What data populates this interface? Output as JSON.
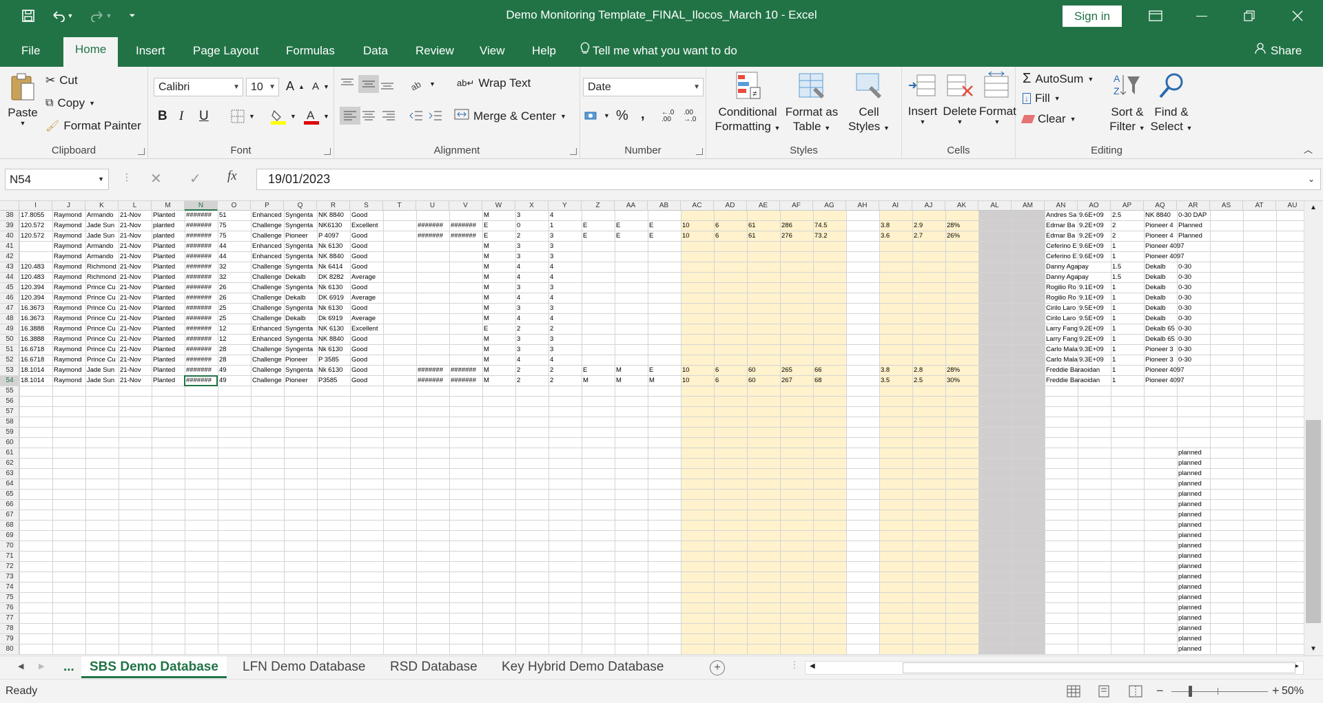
{
  "app": {
    "title": "Demo Monitoring Template_FINAL_Ilocos_March 10  -  Excel",
    "sign_in": "Sign in",
    "share": "Share",
    "tell_me": "Tell me what you want to do"
  },
  "tabs": [
    "File",
    "Home",
    "Insert",
    "Page Layout",
    "Formulas",
    "Data",
    "Review",
    "View",
    "Help"
  ],
  "ribbon": {
    "clipboard": {
      "label": "Clipboard",
      "paste": "Paste",
      "cut": "Cut",
      "copy": "Copy",
      "format_painter": "Format Painter"
    },
    "font": {
      "label": "Font",
      "name": "Calibri",
      "size": "10",
      "bold": "B",
      "italic": "I",
      "underline": "U"
    },
    "alignment": {
      "label": "Alignment",
      "wrap": "Wrap Text",
      "merge": "Merge & Center"
    },
    "number": {
      "label": "Number",
      "format": "Date",
      "percent": "%",
      "comma": ","
    },
    "styles": {
      "label": "Styles",
      "cond1": "Conditional",
      "cond2": "Formatting",
      "fat1": "Format as",
      "fat2": "Table",
      "cs1": "Cell",
      "cs2": "Styles"
    },
    "cells": {
      "label": "Cells",
      "insert": "Insert",
      "delete": "Delete",
      "format": "Format"
    },
    "editing": {
      "label": "Editing",
      "autosum": "AutoSum",
      "fill": "Fill",
      "clear": "Clear",
      "sort1": "Sort &",
      "sort2": "Filter",
      "find1": "Find &",
      "find2": "Select"
    }
  },
  "formula_bar": {
    "name_box": "N54",
    "fx": "fx",
    "value": "19/01/2023"
  },
  "sheet": {
    "columns": [
      "I",
      "J",
      "K",
      "L",
      "M",
      "N",
      "O",
      "P",
      "Q",
      "R",
      "S",
      "T",
      "U",
      "V",
      "W",
      "X",
      "Y",
      "Z",
      "AA",
      "AB",
      "AC",
      "AD",
      "AE",
      "AF",
      "AG",
      "AH",
      "AI",
      "AJ",
      "AK",
      "AL",
      "AM",
      "AN",
      "AO",
      "AP",
      "AQ",
      "AR",
      "AS",
      "AT",
      "AU"
    ],
    "selected_column": "N",
    "row_numbers": [
      "38",
      "39",
      "40",
      "41",
      "42",
      "43",
      "44",
      "45",
      "46",
      "47",
      "48",
      "49",
      "50",
      "51",
      "52",
      "53",
      "54",
      "55",
      "56",
      "57",
      "58",
      "59",
      "60",
      "61",
      "62",
      "63",
      "64",
      "65",
      "66",
      "67",
      "68",
      "69",
      "70",
      "71",
      "72",
      "73",
      "74",
      "75",
      "76",
      "77",
      "78",
      "79",
      "80"
    ],
    "selected_row": "54",
    "rows": [
      [
        "17.8055",
        "Raymond",
        "Armando",
        "21-Nov",
        "Planted",
        "#######",
        "51",
        "Enhanced",
        "Syngenta",
        "NK 8840",
        "Good",
        "",
        "",
        "",
        "M",
        "3",
        "4",
        "",
        "",
        "",
        "",
        "",
        "",
        "",
        "",
        "",
        "",
        "",
        "",
        "",
        "",
        "Andres Sa",
        "9.6E+09",
        "2.5",
        "NK 8840",
        "0-30 DAP",
        "",
        "",
        ""
      ],
      [
        "120.572",
        "Raymond",
        "Jade Sun",
        "21-Nov",
        "planted",
        "#######",
        "75",
        "Challenge",
        "Syngenta",
        "NK6130",
        "Excellent",
        "",
        "#######",
        "#######",
        "E",
        "0",
        "1",
        "E",
        "E",
        "E",
        "10",
        "6",
        "61",
        "286",
        "74.5",
        "",
        "3.8",
        "2.9",
        "28%",
        "",
        "",
        "Edmar Ba",
        "9.2E+09",
        "2",
        "Pioneer 4",
        "Planned",
        "",
        "",
        ""
      ],
      [
        "120.572",
        "Raymond",
        "Jade Sun",
        "21-Nov",
        "planted",
        "#######",
        "75",
        "Challenge",
        "Pioneer",
        "P 4097",
        "Good",
        "",
        "#######",
        "#######",
        "E",
        "2",
        "3",
        "E",
        "E",
        "E",
        "10",
        "6",
        "61",
        "276",
        "73.2",
        "",
        "3.6",
        "2.7",
        "26%",
        "",
        "",
        "Edmar Ba",
        "9.2E+09",
        "2",
        "Pioneer 4",
        "Planned",
        "",
        "",
        ""
      ],
      [
        "",
        "Raymond",
        "Armando",
        "21-Nov",
        "Planted",
        "#######",
        "44",
        "Enhanced",
        "Syngenta",
        "Nk 6130",
        "Good",
        "",
        "",
        "",
        "M",
        "3",
        "3",
        "",
        "",
        "",
        "",
        "",
        "",
        "",
        "",
        "",
        "",
        "",
        "",
        "",
        "",
        "Ceferino E",
        "9.6E+09",
        "1",
        "Pioneer 4097",
        "",
        "",
        "",
        ""
      ],
      [
        "",
        "Raymond",
        "Armando",
        "21-Nov",
        "Planted",
        "#######",
        "44",
        "Enhanced",
        "Syngenta",
        "NK 8840",
        "Good",
        "",
        "",
        "",
        "M",
        "3",
        "3",
        "",
        "",
        "",
        "",
        "",
        "",
        "",
        "",
        "",
        "",
        "",
        "",
        "",
        "",
        "Ceferino E",
        "9.6E+09",
        "1",
        "Pioneer 4097",
        "",
        "",
        "",
        ""
      ],
      [
        "120.483",
        "Raymond",
        "Richmond",
        "21-Nov",
        "Planted",
        "#######",
        "32",
        "Challenge",
        "Syngenta",
        "Nk 6414",
        "Good",
        "",
        "",
        "",
        "M",
        "4",
        "4",
        "",
        "",
        "",
        "",
        "",
        "",
        "",
        "",
        "",
        "",
        "",
        "",
        "",
        "",
        "Danny Agapay",
        "",
        "1.5",
        "Dekalb",
        "0-30",
        "",
        "",
        ""
      ],
      [
        "120.483",
        "Raymond",
        "Richmond",
        "21-Nov",
        "Planted",
        "#######",
        "32",
        "Challenge",
        "Dekalb",
        "DK 8282",
        "Average",
        "",
        "",
        "",
        "M",
        "4",
        "4",
        "",
        "",
        "",
        "",
        "",
        "",
        "",
        "",
        "",
        "",
        "",
        "",
        "",
        "",
        "Danny Agapay",
        "",
        "1.5",
        "Dekalb",
        "0-30",
        "",
        "",
        ""
      ],
      [
        "120.394",
        "Raymond",
        "Prince Cu",
        "21-Nov",
        "Planted",
        "#######",
        "26",
        "Challenge",
        "Syngenta",
        "Nk 6130",
        "Good",
        "",
        "",
        "",
        "M",
        "3",
        "3",
        "",
        "",
        "",
        "",
        "",
        "",
        "",
        "",
        "",
        "",
        "",
        "",
        "",
        "",
        "Rogilio Ro",
        "9.1E+09",
        "1",
        "Dekalb",
        "0-30",
        "",
        "",
        ""
      ],
      [
        "120.394",
        "Raymond",
        "Prince Cu",
        "21-Nov",
        "Planted",
        "#######",
        "26",
        "Challenge",
        "Dekalb",
        "DK 6919",
        "Average",
        "",
        "",
        "",
        "M",
        "4",
        "4",
        "",
        "",
        "",
        "",
        "",
        "",
        "",
        "",
        "",
        "",
        "",
        "",
        "",
        "",
        "Rogilio Ro",
        "9.1E+09",
        "1",
        "Dekalb",
        "0-30",
        "",
        "",
        ""
      ],
      [
        "16.3673",
        "Raymond",
        "Prince Cu",
        "21-Nov",
        "Planted",
        "#######",
        "25",
        "Challenge",
        "Syngenta",
        "Nk 6130",
        "Good",
        "",
        "",
        "",
        "M",
        "3",
        "3",
        "",
        "",
        "",
        "",
        "",
        "",
        "",
        "",
        "",
        "",
        "",
        "",
        "",
        "",
        "Cirilo Laro",
        "9.5E+09",
        "1",
        "Dekalb",
        "0-30",
        "",
        "",
        ""
      ],
      [
        "16.3673",
        "Raymond",
        "Prince Cu",
        "21-Nov",
        "Planted",
        "#######",
        "25",
        "Challenge",
        "Dekalb",
        "Dk 6919",
        "Average",
        "",
        "",
        "",
        "M",
        "4",
        "4",
        "",
        "",
        "",
        "",
        "",
        "",
        "",
        "",
        "",
        "",
        "",
        "",
        "",
        "",
        "Cirilo Laro",
        "9.5E+09",
        "1",
        "Dekalb",
        "0-30",
        "",
        "",
        ""
      ],
      [
        "16.3888",
        "Raymond",
        "Prince Cu",
        "21-Nov",
        "Planted",
        "#######",
        "12",
        "Enhanced",
        "Syngenta",
        "NK 6130",
        "Excellent",
        "",
        "",
        "",
        "E",
        "2",
        "2",
        "",
        "",
        "",
        "",
        "",
        "",
        "",
        "",
        "",
        "",
        "",
        "",
        "",
        "",
        "Larry Fang",
        "9.2E+09",
        "1",
        "Dekalb 65",
        "0-30",
        "",
        "",
        ""
      ],
      [
        "16.3888",
        "Raymond",
        "Prince Cu",
        "21-Nov",
        "Planted",
        "#######",
        "12",
        "Enhanced",
        "Syngenta",
        "NK 8840",
        "Good",
        "",
        "",
        "",
        "M",
        "3",
        "3",
        "",
        "",
        "",
        "",
        "",
        "",
        "",
        "",
        "",
        "",
        "",
        "",
        "",
        "",
        "Larry Fang",
        "9.2E+09",
        "1",
        "Dekalb 65",
        "0-30",
        "",
        "",
        ""
      ],
      [
        "16.6718",
        "Raymond",
        "Prince Cu",
        "21-Nov",
        "Planted",
        "#######",
        "28",
        "Challenge",
        "Syngenta",
        "Nk 6130",
        "Good",
        "",
        "",
        "",
        "M",
        "3",
        "3",
        "",
        "",
        "",
        "",
        "",
        "",
        "",
        "",
        "",
        "",
        "",
        "",
        "",
        "",
        "Carlo Mala",
        "9.3E+09",
        "1",
        "Pioneer 3",
        "0-30",
        "",
        "",
        ""
      ],
      [
        "16.6718",
        "Raymond",
        "Prince Cu",
        "21-Nov",
        "Planted",
        "#######",
        "28",
        "Challenge",
        "Pioneer",
        "P 3585",
        "Good",
        "",
        "",
        "",
        "M",
        "4",
        "4",
        "",
        "",
        "",
        "",
        "",
        "",
        "",
        "",
        "",
        "",
        "",
        "",
        "",
        "",
        "Carlo Mala",
        "9.3E+09",
        "1",
        "Pioneer 3",
        "0-30",
        "",
        "",
        ""
      ],
      [
        "18.1014",
        "Raymond",
        "Jade Sun",
        "21-Nov",
        "Planted",
        "#######",
        "49",
        "Challenge",
        "Syngenta",
        "Nk 6130",
        "Good",
        "",
        "#######",
        "#######",
        "M",
        "2",
        "2",
        "E",
        "M",
        "E",
        "10",
        "6",
        "60",
        "265",
        "66",
        "",
        "3.8",
        "2.8",
        "28%",
        "",
        "",
        "Freddie Baraoidan",
        "",
        "1",
        "Pioneer 4097",
        "",
        "",
        "",
        ""
      ],
      [
        "18.1014",
        "Raymond",
        "Jade Sun",
        "21-Nov",
        "Planted",
        "#######",
        "49",
        "Challenge",
        "Pioneer",
        "P3585",
        "Good",
        "",
        "#######",
        "#######",
        "M",
        "2",
        "2",
        "M",
        "M",
        "M",
        "10",
        "6",
        "60",
        "267",
        "68",
        "",
        "3.5",
        "2.5",
        "30%",
        "",
        "",
        "Freddie Baraoidan",
        "",
        "1",
        "Pioneer 4097",
        "",
        "",
        "",
        ""
      ]
    ],
    "planned_text": "planned",
    "planned_rows": [
      "61",
      "62",
      "63",
      "64",
      "65",
      "66",
      "67",
      "68",
      "69",
      "70",
      "71",
      "72",
      "73",
      "74",
      "75",
      "76",
      "77",
      "78",
      "79",
      "80"
    ]
  },
  "sheet_tabs": [
    "SBS Demo Database",
    "LFN Demo Database",
    "RSD Database",
    "Key Hybrid Demo Database"
  ],
  "ellipsis": "...",
  "status": {
    "text": "Ready",
    "zoom": "50%"
  }
}
